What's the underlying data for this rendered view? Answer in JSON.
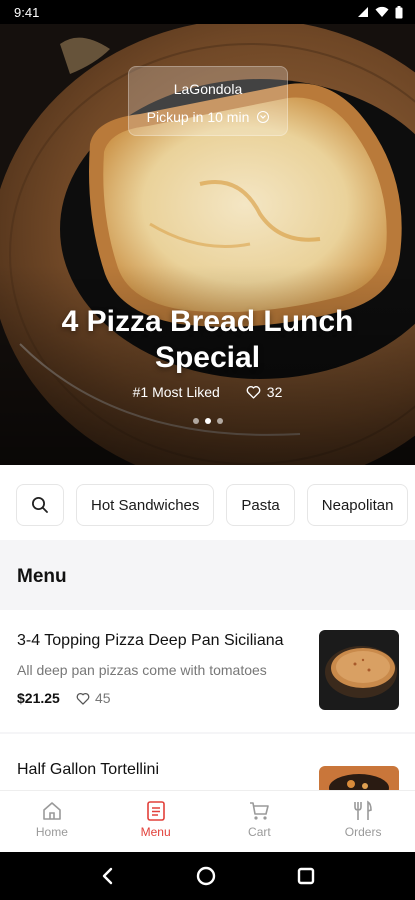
{
  "status_bar": {
    "time": "9:41"
  },
  "hero": {
    "restaurant_name": "LaGondola",
    "pickup_text": "Pickup in 10 min",
    "title": "4 Pizza Bread Lunch Special",
    "badge": "#1 Most Liked",
    "likes": "32",
    "carousel": {
      "count": 3,
      "active_index": 1
    }
  },
  "categories": {
    "search_icon": "search-icon",
    "items": [
      "Hot Sandwiches",
      "Pasta",
      "Neapolitan"
    ]
  },
  "menu": {
    "heading": "Menu",
    "items": [
      {
        "name": "3-4 Topping Pizza Deep Pan Siciliana",
        "description": "All deep pan pizzas come with tomatoes",
        "price": "$21.25",
        "likes": "45"
      },
      {
        "name": "Half Gallon Tortellini",
        "description": "",
        "price": "",
        "likes": ""
      }
    ]
  },
  "bottom_nav": {
    "items": [
      {
        "label": "Home",
        "icon": "home-icon",
        "active": false
      },
      {
        "label": "Menu",
        "icon": "menu-icon",
        "active": true
      },
      {
        "label": "Cart",
        "icon": "cart-icon",
        "active": false
      },
      {
        "label": "Orders",
        "icon": "orders-icon",
        "active": false
      }
    ]
  },
  "colors": {
    "accent": "#e2403a",
    "menu_background": "#f5f5f7",
    "inactive_nav": "#9a9a9a"
  }
}
